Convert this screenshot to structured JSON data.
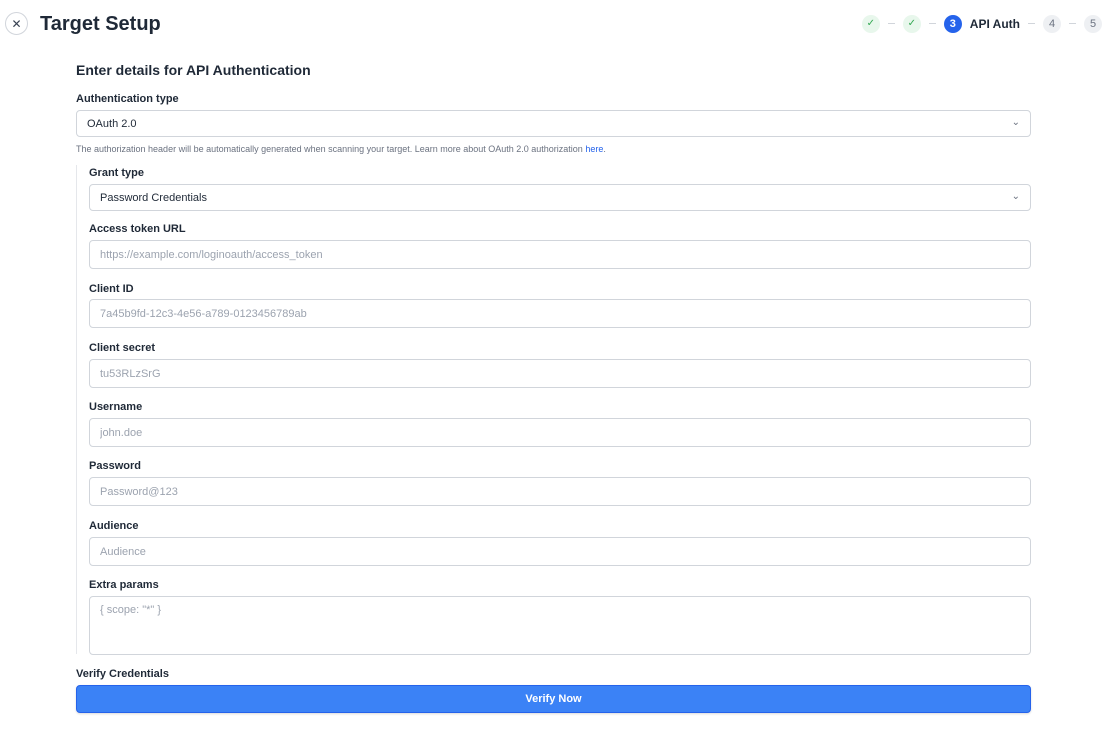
{
  "header": {
    "title": "Target Setup",
    "close_icon": "close-icon"
  },
  "stepper": {
    "steps": [
      {
        "status": "done",
        "glyph": "✓"
      },
      {
        "status": "done",
        "glyph": "✓"
      },
      {
        "status": "active",
        "number": "3",
        "label": "API Auth"
      },
      {
        "status": "pending",
        "number": "4"
      },
      {
        "status": "pending",
        "number": "5"
      }
    ]
  },
  "form": {
    "section_title": "Enter details for API Authentication",
    "auth_type": {
      "label": "Authentication type",
      "value": "OAuth 2.0"
    },
    "help": {
      "text": "The authorization header will be automatically generated when scanning your target. Learn more about OAuth 2.0 authorization ",
      "link": "here",
      "suffix": "."
    },
    "grant_type": {
      "label": "Grant type",
      "value": "Password Credentials"
    },
    "access_token_url": {
      "label": "Access token URL",
      "placeholder": "https://example.com/loginoauth/access_token"
    },
    "client_id": {
      "label": "Client ID",
      "placeholder": "7a45b9fd-12c3-4e56-a789-0123456789ab"
    },
    "client_secret": {
      "label": "Client secret",
      "placeholder": "tu53RLzSrG"
    },
    "username": {
      "label": "Username",
      "placeholder": "john.doe"
    },
    "password": {
      "label": "Password",
      "placeholder": "Password@123"
    },
    "audience": {
      "label": "Audience",
      "placeholder": "Audience"
    },
    "extra_params": {
      "label": "Extra params",
      "placeholder": "{ scope: \"*\" }"
    },
    "verify": {
      "label": "Verify Credentials",
      "button": "Verify Now"
    }
  },
  "colors": {
    "accent": "#3b82f6",
    "done": "#34a853"
  }
}
